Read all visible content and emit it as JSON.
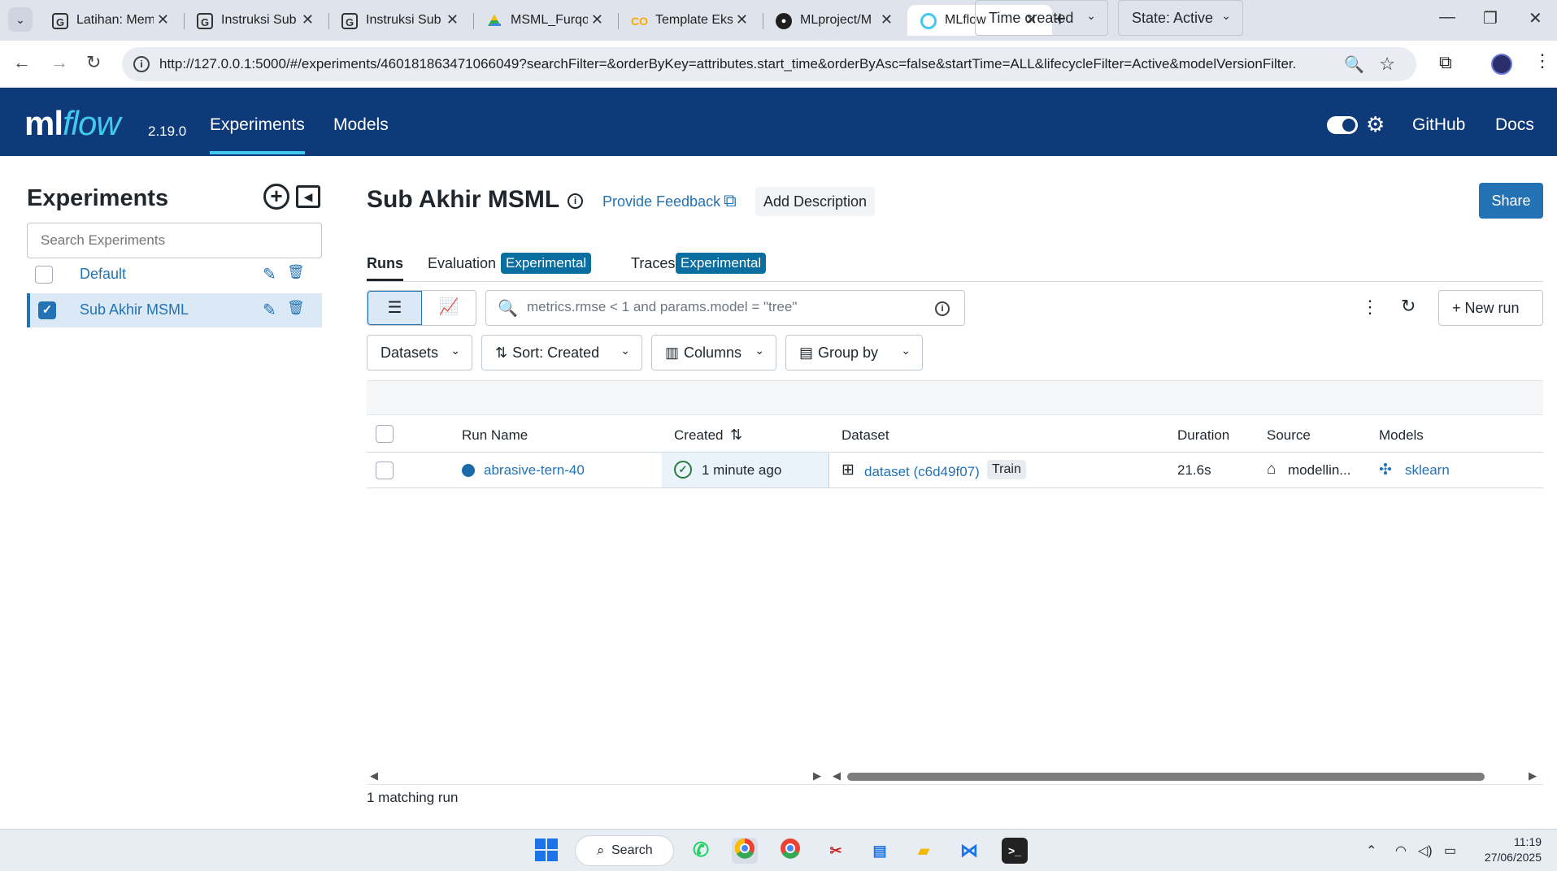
{
  "browser": {
    "tabs": [
      {
        "label": "Latihan: Mem",
        "favicon": "G"
      },
      {
        "label": "Instruksi Sub",
        "favicon": "G"
      },
      {
        "label": "Instruksi Sub",
        "favicon": "G"
      },
      {
        "label": "MSML_Furqo",
        "favicon": "drive-icon"
      },
      {
        "label": "Template Eks",
        "favicon": "colab-icon"
      },
      {
        "label": "MLproject/M",
        "favicon": "github-icon"
      },
      {
        "label": "MLflow",
        "favicon": "mlflow-icon",
        "active": true
      }
    ],
    "url": "http://127.0.0.1:5000/#/experiments/460181863471066049?searchFilter=&orderByKey=attributes.start_time&orderByAsc=false&startTime=ALL&lifecycleFilter=Active&modelVersionFilter..."
  },
  "header": {
    "logo_ml": "ml",
    "logo_flow": "flow",
    "version": "2.19.0",
    "nav": [
      "Experiments",
      "Models"
    ],
    "links": [
      "GitHub",
      "Docs"
    ]
  },
  "sidebar": {
    "title": "Experiments",
    "search_placeholder": "Search Experiments",
    "items": [
      {
        "name": "Default",
        "checked": false
      },
      {
        "name": "Sub Akhir MSML",
        "checked": true
      }
    ]
  },
  "main": {
    "title": "Sub Akhir MSML",
    "feedback": "Provide Feedback",
    "add_description": "Add Description",
    "share": "Share",
    "tabs": [
      {
        "label": "Runs"
      },
      {
        "label": "Evaluation",
        "badge": "Experimental"
      },
      {
        "label": "Traces",
        "badge": "Experimental"
      }
    ],
    "search_placeholder": "metrics.rmse < 1 and params.model = \"tree\"",
    "time_filter": "Time created",
    "state_filter": "State: Active",
    "new_run": "New run",
    "datasets": "Datasets",
    "sort": "Sort: Created",
    "columns": "Columns",
    "group_by": "Group by",
    "table": {
      "headers": [
        "Run Name",
        "Created",
        "Dataset",
        "Duration",
        "Source",
        "Models"
      ],
      "rows": [
        {
          "run_name": "abrasive-tern-40",
          "created": "1 minute ago",
          "dataset": "dataset (c6d49f07)",
          "dataset_tag": "Train",
          "duration": "21.6s",
          "source": "modellin...",
          "model": "sklearn"
        }
      ]
    },
    "matching": "1 matching run"
  },
  "taskbar": {
    "search": "Search",
    "time": "11:19",
    "date": "27/06/2025"
  },
  "colors": {
    "header_bg": "#0e3a7a",
    "accent": "#2272b4",
    "flow_cyan": "#43c9ed",
    "badge": "#0b6ea0"
  }
}
